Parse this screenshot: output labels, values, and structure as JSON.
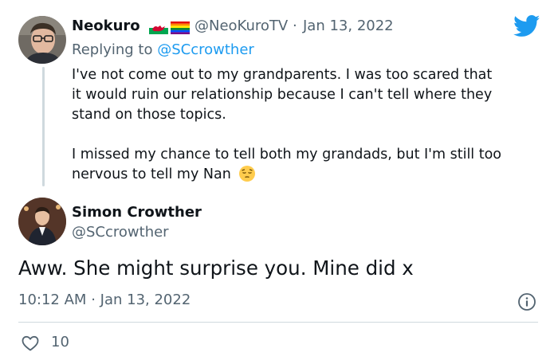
{
  "parent_tweet": {
    "author_name": "Neokuro",
    "handle": "@NeoKuroTV",
    "separator": "·",
    "date": "Jan 13, 2022",
    "replying_to_label": "Replying to",
    "replying_to_handle": "@SCcrowther",
    "paragraph_1_line_1": "I've not come out to my grandparents. I was too scared that",
    "paragraph_1_line_2": "it would ruin our relationship because I can't tell where they",
    "paragraph_1_line_3": "stand on those topics.",
    "paragraph_2_line_1": "I missed my chance to tell both my grandads, but I'm still too",
    "paragraph_2_line_2": "nervous to tell my Nan",
    "flags": [
      "welsh-flag-icon",
      "rainbow-flag-icon"
    ],
    "emoji": "pensive-face-icon"
  },
  "main_tweet": {
    "author_name": "Simon Crowther",
    "handle": "@SCcrowther",
    "text": "Aww. She might surprise you. Mine did x",
    "time": "10:12 AM",
    "separator": "·",
    "date": "Jan 13, 2022",
    "likes": "10"
  },
  "icons": {
    "brand": "twitter-bird-icon",
    "info": "info-icon",
    "like": "heart-icon"
  },
  "colors": {
    "brand_blue": "#1d9bf0",
    "text_primary": "#0f1419",
    "text_secondary": "#536471",
    "line": "#cfd9de"
  }
}
